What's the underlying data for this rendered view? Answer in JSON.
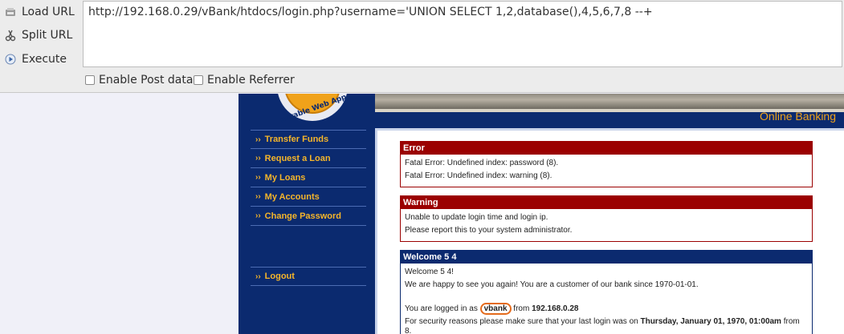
{
  "toolbar": {
    "load_url": "Load URL",
    "split_url": "Split URL",
    "execute": "Execute",
    "url_value": "http://192.168.0.29/vBank/htdocs/login.php?username='UNION SELECT 1,2,database(),4,5,6,7,8 --+",
    "enable_post": "Enable Post data",
    "enable_referrer": "Enable Referrer"
  },
  "header": {
    "online_banking": "Online Banking",
    "logo_text": "nerable Web App"
  },
  "sidebar": {
    "items": [
      {
        "label": "Transfer Funds"
      },
      {
        "label": "Request a Loan"
      },
      {
        "label": "My Loans"
      },
      {
        "label": "My Accounts"
      },
      {
        "label": "Change Password"
      }
    ],
    "logout": "Logout",
    "bullet": "››"
  },
  "error": {
    "title": "Error",
    "lines": [
      "Fatal Error: Undefined index: password (8).",
      "Fatal Error: Undefined index: warning (8)."
    ]
  },
  "warning": {
    "title": "Warning",
    "lines": [
      "Unable to update login time and login ip.",
      "Please report this to your system administrator."
    ]
  },
  "welcome": {
    "title": "Welcome 5 4",
    "greeting": "Welcome 5 4!",
    "happy": "We are happy to see you again! You are a customer of our bank since 1970-01-01.",
    "logged_prefix": "You are logged in as",
    "logged_user": "vbank",
    "logged_mid": "from",
    "logged_ip": "192.168.0.28",
    "security_prefix": "For security reasons please make sure that your last login was on",
    "security_date": "Thursday, January 01, 1970, 01:00am",
    "security_suffix": "from 8."
  },
  "colors": {
    "page_bg": "#0b2a6f",
    "accent_orange": "#f0a21a",
    "error_red": "#9b0000",
    "highlight": "#e46a1b"
  }
}
